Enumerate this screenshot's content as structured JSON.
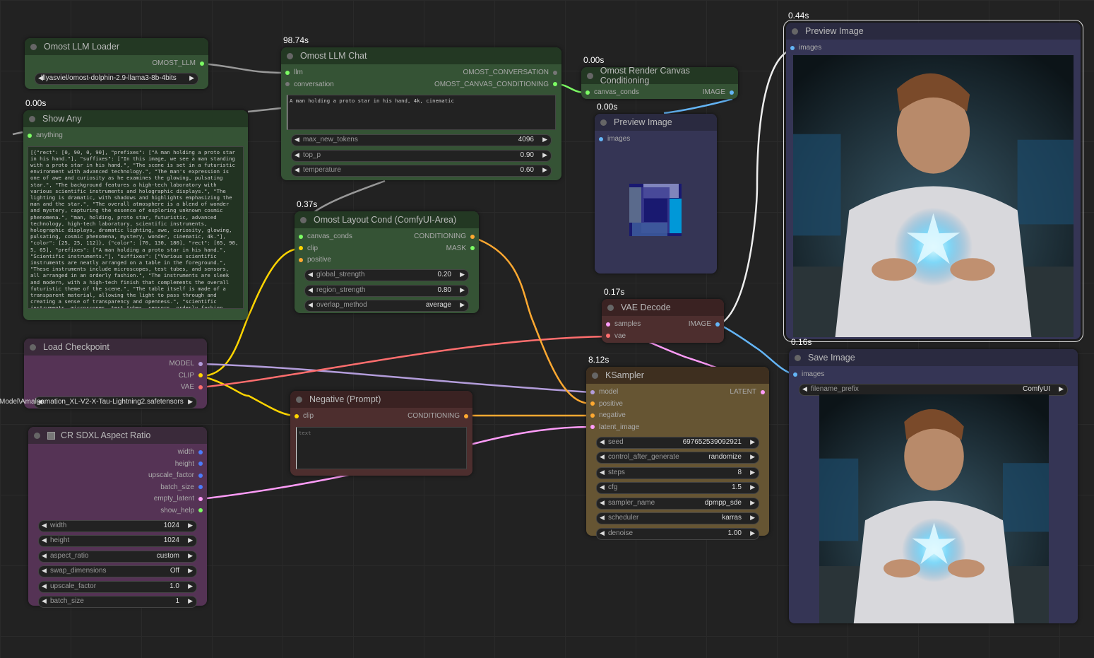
{
  "colors": {
    "background": "#222222",
    "model": "#b39ddb",
    "clip": "#ffd500",
    "vae": "#ff6e6e",
    "conditioning": "#ffa931",
    "latent": "#ff9cf9",
    "image": "#64b5f6",
    "llm": "#7cfc64",
    "int": "#4a7cff"
  },
  "nodes": {
    "llm_loader": {
      "title": "Omost LLM Loader",
      "timing": "",
      "outputs": [
        {
          "label": "OMOST_LLM",
          "type": "llm"
        }
      ],
      "widgets": [
        {
          "label": "",
          "value": "lllyasviel/omost-dolphin-2.9-llama3-8b-4bits"
        }
      ]
    },
    "llm_chat": {
      "title": "Omost LLM Chat",
      "timing": "98.74s",
      "inputs": [
        {
          "label": "llm",
          "type": "llm"
        },
        {
          "label": "conversation",
          "type": "gray"
        }
      ],
      "outputs": [
        {
          "label": "OMOST_CONVERSATION",
          "type": "gray"
        },
        {
          "label": "OMOST_CANVAS_CONDITIONING",
          "type": "llm"
        }
      ],
      "text": "A man holding a proto star in his hand, 4k, cinematic",
      "widgets": [
        {
          "label": "max_new_tokens",
          "value": "4096"
        },
        {
          "label": "top_p",
          "value": "0.90"
        },
        {
          "label": "temperature",
          "value": "0.60"
        }
      ]
    },
    "show_any": {
      "title": "Show Any",
      "timing": "0.00s",
      "inputs": [
        {
          "label": "anything",
          "type": "llm"
        }
      ],
      "text": "[{\"rect\": [0, 90, 0, 90], \"prefixes\": [\"A man holding a proto star in his hand.\"], \"suffixes\": [\"In this image, we see a man standing with a proto star in his hand.\", \"The scene is set in a futuristic environment with advanced technology.\", \"The man's expression is one of awe and curiosity as he examines the glowing, pulsating star.\", \"The background features a high-tech laboratory with various scientific instruments and holographic displays.\", \"The lighting is dramatic, with shadows and highlights emphasizing the man and the star.\", \"The overall atmosphere is a blend of wonder and mystery, capturing the essence of exploring unknown cosmic phenomena.\", \"man, holding, proto star, futuristic, advanced technology, high-tech laboratory, scientific instruments, holographic displays, dramatic lighting, awe, curiosity, glowing, pulsating, cosmic phenomena, mystery, wonder, cinematic, 4k.\"], \"color\": [25, 25, 112]}, {\"color\": [70, 130, 180], \"rect\": [65, 90, 5, 65], \"prefixes\": [\"A man holding a proto star in his hand.\", \"Scientific instruments.\"], \"suffixes\": [\"Various scientific instruments are neatly arranged on a table in the foreground.\", \"These instruments include microscopes, test tubes, and sensors, all arranged in an orderly fashion.\", \"The instruments are sleek and modern, with a high-tech finish that complements the overall futuristic theme of the scene.\", \"The table itself is made of a transparent material, allowing the light to pass through and creating a sense of transparency and openness.\", \"scientific instruments, microscopes, test tubes, sensors, orderly fashion"
    },
    "render_canvas": {
      "title": "Omost Render Canvas Conditioning",
      "timing": "0.00s",
      "inputs": [
        {
          "label": "canvas_conds",
          "type": "llm"
        }
      ],
      "outputs": [
        {
          "label": "IMAGE",
          "type": "image"
        }
      ]
    },
    "preview_small": {
      "title": "Preview Image",
      "timing": "0.00s",
      "inputs": [
        {
          "label": "images",
          "type": "image"
        }
      ]
    },
    "layout_cond": {
      "title": "Omost Layout Cond (ComfyUI-Area)",
      "timing": "0.37s",
      "inputs": [
        {
          "label": "canvas_conds",
          "type": "llm"
        },
        {
          "label": "clip",
          "type": "clip"
        },
        {
          "label": "positive",
          "type": "conditioning"
        }
      ],
      "outputs": [
        {
          "label": "CONDITIONING",
          "type": "conditioning"
        },
        {
          "label": "MASK",
          "type": "llm"
        }
      ],
      "widgets": [
        {
          "label": "global_strength",
          "value": "0.20"
        },
        {
          "label": "region_strength",
          "value": "0.80"
        },
        {
          "label": "overlap_method",
          "value": "average"
        }
      ]
    },
    "load_checkpoint": {
      "title": "Load Checkpoint",
      "timing": "",
      "outputs": [
        {
          "label": "MODEL",
          "type": "model"
        },
        {
          "label": "CLIP",
          "type": "clip"
        },
        {
          "label": "VAE",
          "type": "vae"
        }
      ],
      "widgets": [
        {
          "label": "",
          "value": "Model\\Amalgamation_XL-V2-X-Tau-Lightning2.safetensors"
        }
      ]
    },
    "aspect_ratio": {
      "title": "CR SDXL Aspect Ratio",
      "timing": "",
      "outputs": [
        {
          "label": "width",
          "type": "int"
        },
        {
          "label": "height",
          "type": "int"
        },
        {
          "label": "upscale_factor",
          "type": "int"
        },
        {
          "label": "batch_size",
          "type": "int"
        },
        {
          "label": "empty_latent",
          "type": "latent"
        },
        {
          "label": "show_help",
          "type": "llm"
        }
      ],
      "widgets": [
        {
          "label": "width",
          "value": "1024"
        },
        {
          "label": "height",
          "value": "1024"
        },
        {
          "label": "aspect_ratio",
          "value": "custom"
        },
        {
          "label": "swap_dimensions",
          "value": "Off"
        },
        {
          "label": "upscale_factor",
          "value": "1.0"
        },
        {
          "label": "batch_size",
          "value": "1"
        }
      ]
    },
    "negative": {
      "title": "Negative (Prompt)",
      "timing": "",
      "inputs": [
        {
          "label": "clip",
          "type": "clip"
        }
      ],
      "outputs": [
        {
          "label": "CONDITIONING",
          "type": "conditioning"
        }
      ],
      "placeholder": "text"
    },
    "vae_decode": {
      "title": "VAE Decode",
      "timing": "0.17s",
      "inputs": [
        {
          "label": "samples",
          "type": "latent"
        },
        {
          "label": "vae",
          "type": "vae"
        }
      ],
      "outputs": [
        {
          "label": "IMAGE",
          "type": "image"
        }
      ]
    },
    "ksampler": {
      "title": "KSampler",
      "timing": "8.12s",
      "inputs": [
        {
          "label": "model",
          "type": "model"
        },
        {
          "label": "positive",
          "type": "conditioning"
        },
        {
          "label": "negative",
          "type": "conditioning"
        },
        {
          "label": "latent_image",
          "type": "latent"
        }
      ],
      "outputs": [
        {
          "label": "LATENT",
          "type": "latent"
        }
      ],
      "widgets": [
        {
          "label": "seed",
          "value": "697652539092921"
        },
        {
          "label": "control_after_generate",
          "value": "randomize"
        },
        {
          "label": "steps",
          "value": "8"
        },
        {
          "label": "cfg",
          "value": "1.5"
        },
        {
          "label": "sampler_name",
          "value": "dpmpp_sde"
        },
        {
          "label": "scheduler",
          "value": "karras"
        },
        {
          "label": "denoise",
          "value": "1.00"
        }
      ]
    },
    "preview_large": {
      "title": "Preview Image",
      "timing": "0.44s",
      "inputs": [
        {
          "label": "images",
          "type": "image"
        }
      ]
    },
    "save_image": {
      "title": "Save Image",
      "timing": "0.16s",
      "inputs": [
        {
          "label": "images",
          "type": "image"
        }
      ],
      "widgets": [
        {
          "label": "filename_prefix",
          "value": "ComfyUI"
        }
      ]
    }
  }
}
